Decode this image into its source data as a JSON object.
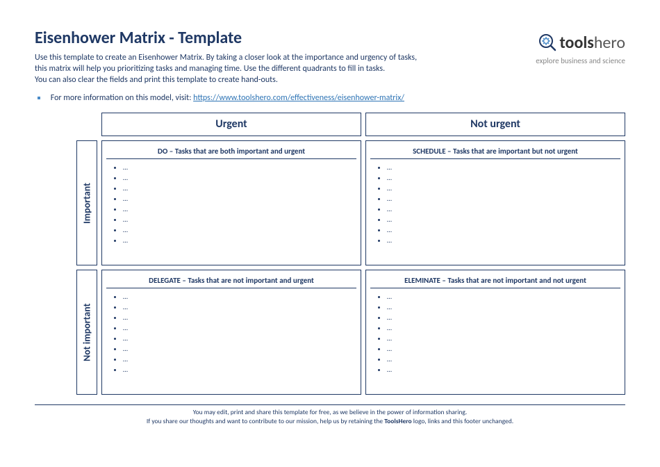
{
  "header": {
    "title": "Eisenhower Matrix - Template",
    "intro_line1": "Use this template to create an Eisenhower Matrix. By taking a closer look at the importance and urgency of tasks,",
    "intro_line2": "this matrix will help you prioritizing tasks and managing time. Use the different quadrants to fill in tasks.",
    "intro_line3": "You can also clear the fields and print this template to create hand-outs.",
    "info_prefix": "For more information on this model, visit: ",
    "info_link": "https://www.toolshero.com/effectiveness/eisenhower-matrix/",
    "logo_bold": "tools",
    "logo_thin": "hero",
    "tagline": "explore business and science"
  },
  "matrix": {
    "col1": "Urgent",
    "col2": "Not urgent",
    "row1": "Important",
    "row2": "Not important",
    "q1_title": "DO – Tasks that are both important and urgent",
    "q2_title": "SCHEDULE – Tasks that are important but not urgent",
    "q3_title": "DELEGATE – Tasks that are not important and urgent",
    "q4_title": "ELEMINATE – Tasks that are not important and not urgent",
    "placeholder": "…"
  },
  "footer": {
    "line1_a": "You may edit, print and share this template for free, as we believe in the power of information sharing.",
    "line2_a": "If you share our thoughts and want to contribute to our mission, help us by retaining the ",
    "line2_bold": "ToolsHero",
    "line2_b": " logo, links and this footer unchanged."
  }
}
